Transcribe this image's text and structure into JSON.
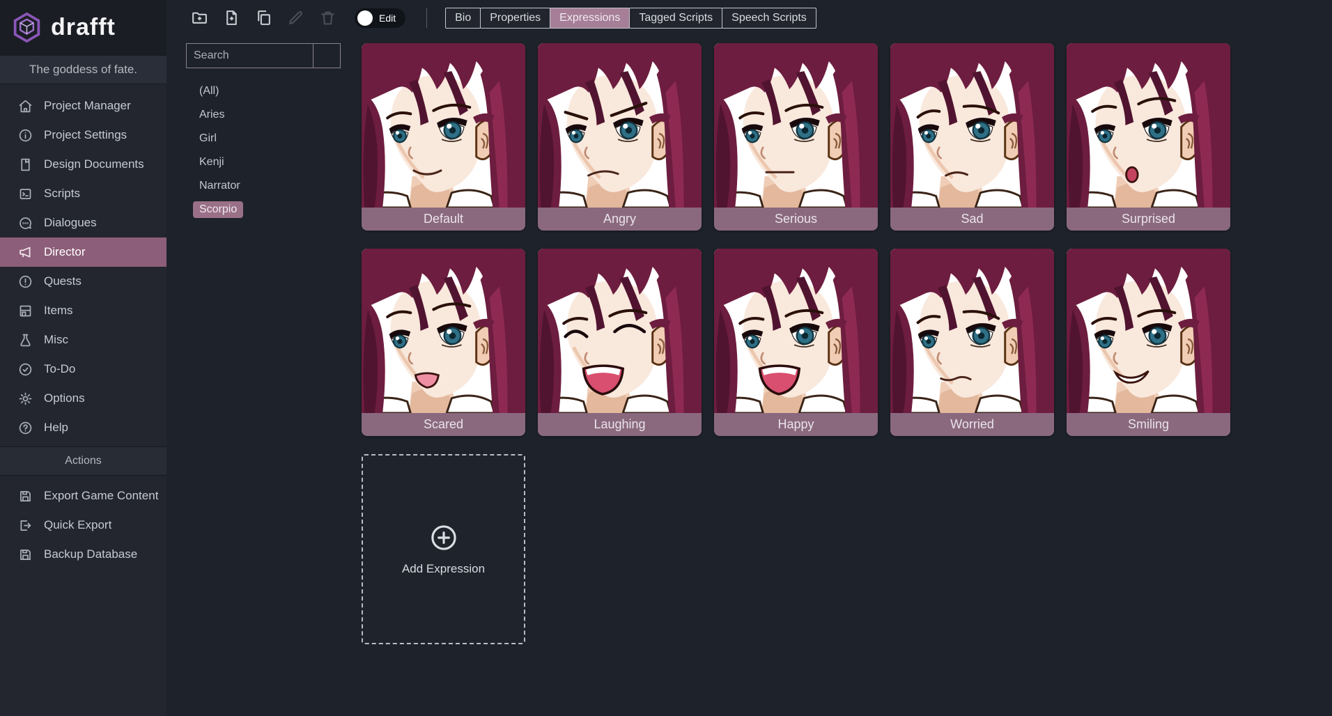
{
  "app": {
    "name": "drafft",
    "subtitle": "The goddess of fate."
  },
  "colors": {
    "accent_active": "#8d5e79",
    "tab_active": "#a67e97",
    "chip_selected": "#9a7088",
    "card_label": "#8a697f",
    "logo_purple": "#8a56b8",
    "background": "#1e222b",
    "sidebar": "#23262f"
  },
  "sidebar": {
    "items": [
      {
        "label": "Project Manager",
        "icon": "home",
        "active": false
      },
      {
        "label": "Project Settings",
        "icon": "info",
        "active": false
      },
      {
        "label": "Design Documents",
        "icon": "doc",
        "active": false
      },
      {
        "label": "Scripts",
        "icon": "terminal",
        "active": false
      },
      {
        "label": "Dialogues",
        "icon": "chat",
        "active": false
      },
      {
        "label": "Director",
        "icon": "megaphone",
        "active": true
      },
      {
        "label": "Quests",
        "icon": "alert",
        "active": false
      },
      {
        "label": "Items",
        "icon": "archive",
        "active": false
      },
      {
        "label": "Misc",
        "icon": "flask",
        "active": false
      },
      {
        "label": "To-Do",
        "icon": "check",
        "active": false
      },
      {
        "label": "Options",
        "icon": "gear",
        "active": false
      },
      {
        "label": "Help",
        "icon": "question",
        "active": false
      }
    ],
    "actions_header": "Actions",
    "actions": [
      {
        "label": "Export Game Content",
        "icon": "save"
      },
      {
        "label": "Quick Export",
        "icon": "export"
      },
      {
        "label": "Backup Database",
        "icon": "save"
      }
    ]
  },
  "toolbar": {
    "edit_label": "Edit",
    "buttons": [
      {
        "name": "new-folder",
        "icon": "folder-plus",
        "enabled": true
      },
      {
        "name": "new-file",
        "icon": "file-plus",
        "enabled": true
      },
      {
        "name": "duplicate",
        "icon": "copy",
        "enabled": true
      },
      {
        "name": "rename",
        "icon": "pencil",
        "enabled": false
      },
      {
        "name": "delete",
        "icon": "trash",
        "enabled": false
      }
    ]
  },
  "tabs": [
    {
      "label": "Bio",
      "active": false
    },
    {
      "label": "Properties",
      "active": false
    },
    {
      "label": "Expressions",
      "active": true
    },
    {
      "label": "Tagged Scripts",
      "active": false
    },
    {
      "label": "Speech Scripts",
      "active": false
    }
  ],
  "search": {
    "placeholder": "Search"
  },
  "characters": [
    {
      "label": "(All)",
      "selected": false
    },
    {
      "label": "Aries",
      "selected": false
    },
    {
      "label": "Girl",
      "selected": false
    },
    {
      "label": "Kenji",
      "selected": false
    },
    {
      "label": "Narrator",
      "selected": false
    },
    {
      "label": "Scorpio",
      "selected": true
    }
  ],
  "expressions": [
    {
      "label": "Default",
      "variant": "default"
    },
    {
      "label": "Angry",
      "variant": "angry"
    },
    {
      "label": "Serious",
      "variant": "serious"
    },
    {
      "label": "Sad",
      "variant": "sad"
    },
    {
      "label": "Surprised",
      "variant": "surprised"
    },
    {
      "label": "Scared",
      "variant": "scared"
    },
    {
      "label": "Laughing",
      "variant": "laughing"
    },
    {
      "label": "Happy",
      "variant": "happy"
    },
    {
      "label": "Worried",
      "variant": "worried"
    },
    {
      "label": "Smiling",
      "variant": "smiling"
    }
  ],
  "add_expression": {
    "label": "Add Expression"
  }
}
